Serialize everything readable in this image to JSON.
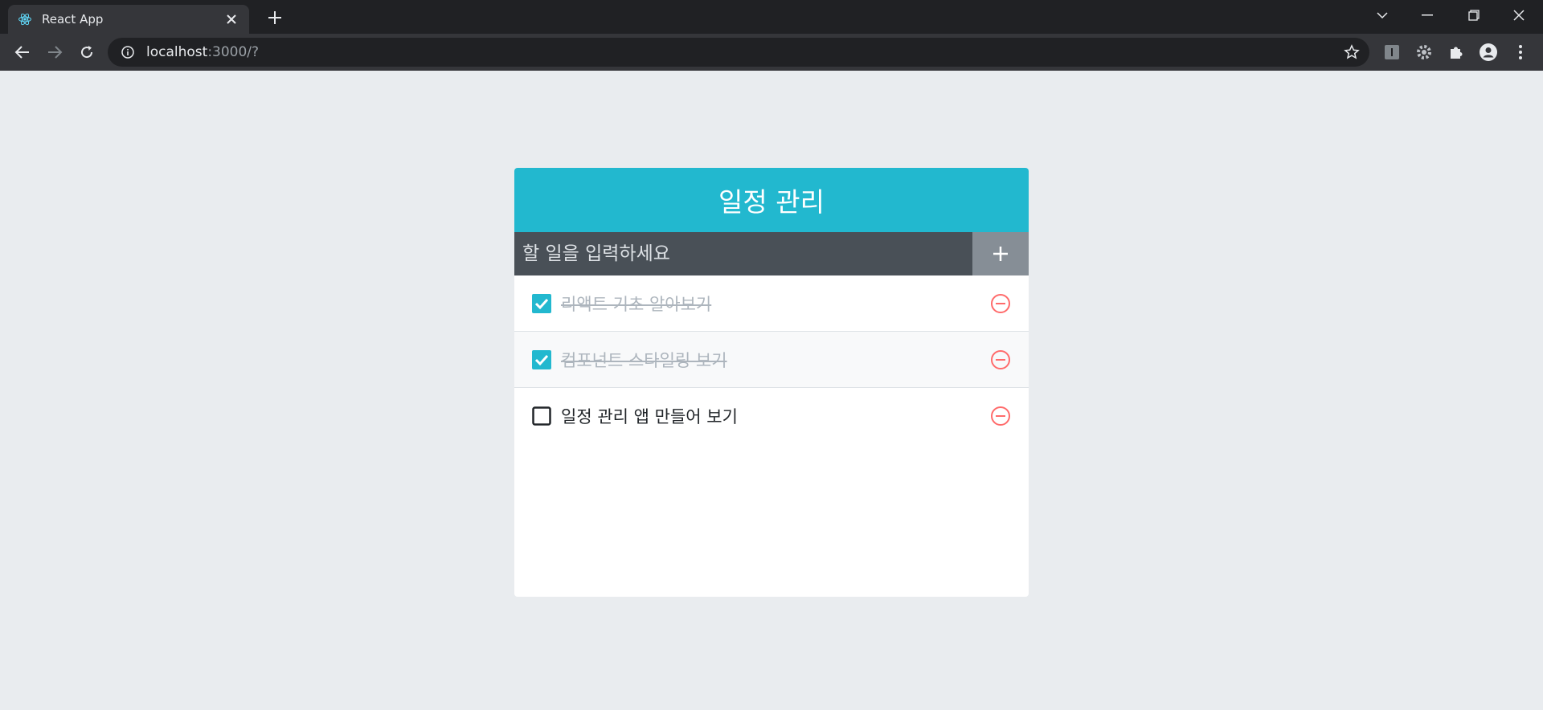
{
  "browser": {
    "tab_title": "React App",
    "url_host": "localhost",
    "url_path": ":3000/?"
  },
  "app": {
    "title": "일정 관리",
    "input_placeholder": "할 일을 입력하세요",
    "add_button_label": "+",
    "todos": [
      {
        "text": "리액트 기초 알아보기",
        "checked": true
      },
      {
        "text": "컴포넌트 스타일링 보기",
        "checked": true
      },
      {
        "text": "일정 관리 앱 만들어 보기",
        "checked": false
      }
    ]
  },
  "colors": {
    "header": "#22b8cf",
    "input_bar": "#495057",
    "add_button": "#868e96",
    "remove_icon": "#ff6b6b",
    "checked": "#22b8cf",
    "background": "#e9ecef"
  },
  "icons": {
    "favicon": "react-icon",
    "checked": "checkbox-checked-icon",
    "unchecked": "checkbox-blank-icon",
    "remove": "minus-circle-icon"
  }
}
